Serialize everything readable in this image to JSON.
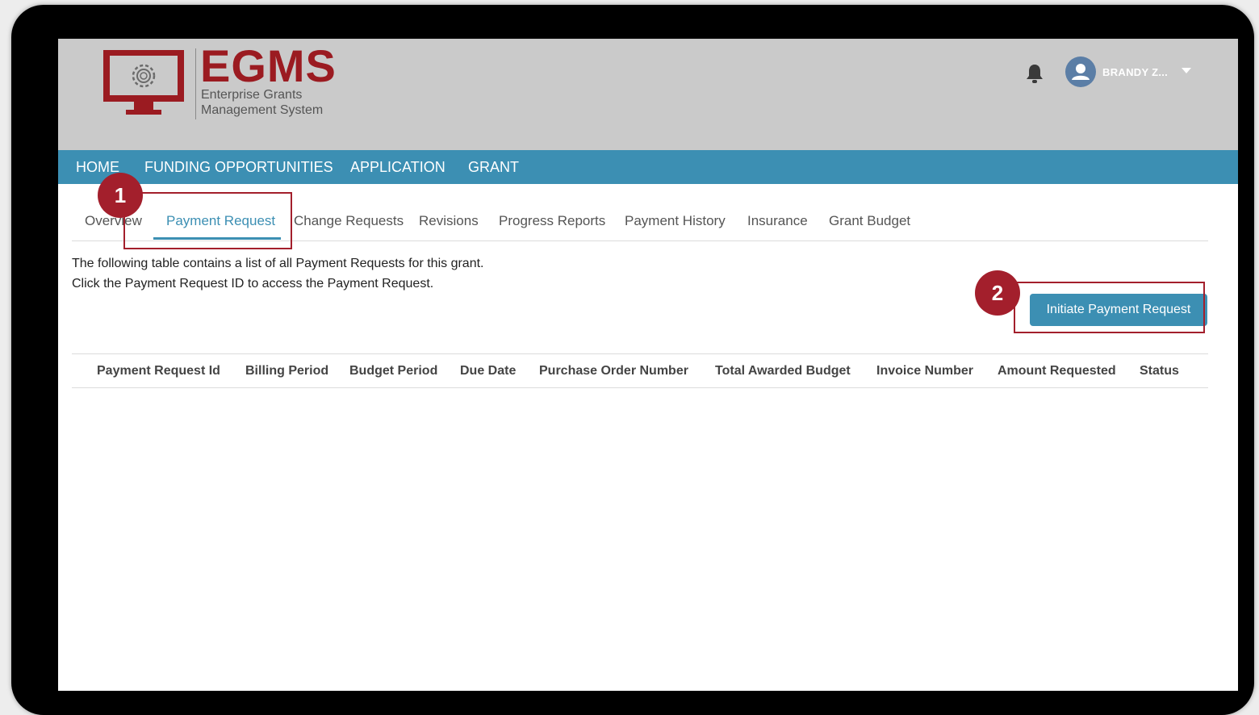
{
  "header": {
    "logo_title": "EGMS",
    "logo_subtitle_line1": "Enterprise Grants",
    "logo_subtitle_line2": "Management System",
    "user_name": "BRANDY Z..."
  },
  "nav": {
    "items": [
      "HOME",
      "FUNDING OPPORTUNITIES",
      "APPLICATION",
      "GRANT"
    ]
  },
  "tabs": {
    "items": [
      "Overview",
      "Payment Request",
      "Change Requests",
      "Revisions",
      "Progress Reports",
      "Payment History",
      "Insurance",
      "Grant Budget"
    ],
    "active": "Payment Request"
  },
  "content": {
    "description_line1": "The following table contains a list of all Payment Requests for this grant.",
    "description_line2": "Click the Payment Request ID to access the Payment Request.",
    "initiate_button": "Initiate Payment Request"
  },
  "table": {
    "columns": [
      "Payment Request Id",
      "Billing Period",
      "Budget Period",
      "Due Date",
      "Purchase Order Number",
      "Total Awarded Budget",
      "Invoice Number",
      "Amount Requested",
      "Status"
    ],
    "rows": []
  },
  "callouts": {
    "one": "1",
    "two": "2"
  },
  "colors": {
    "brand_red": "#9b1b21",
    "nav_blue": "#3c8fb3",
    "callout_red": "#a31f2c",
    "header_gray": "#cacaca"
  }
}
